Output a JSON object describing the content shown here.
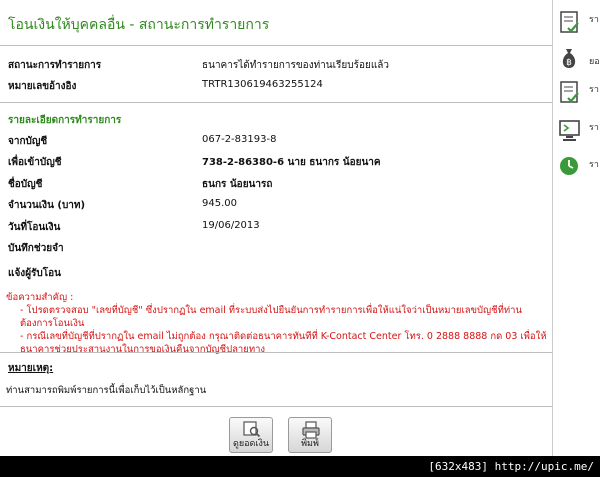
{
  "page": {
    "title": "โอนเงินให้บุคคลอื่น - สถานะการทำรายการ"
  },
  "status": {
    "label": "สถานะการทำรายการ",
    "value": "ธนาคารได้ทำรายการของท่านเรียบร้อยแล้ว"
  },
  "reference": {
    "label": "หมายเลขอ้างอิง",
    "value": "TRTR130619463255124"
  },
  "details": {
    "heading": "รายละเอียดการทำรายการ",
    "from_account_label": "จากบัญชี",
    "from_account_value": "067-2-83193-8",
    "to_account_label": "เพื่อเข้าบัญชี",
    "to_account_value": "738-2-86380-6 นาย ธนากร น้อยนาค",
    "account_name_label": "ชื่อบัญชี",
    "account_name_value": "ธนกร น้อยนารถ",
    "amount_label": "จำนวนเงิน (บาท)",
    "amount_value": "945.00",
    "date_label": "วันที่โอนเงิน",
    "date_value": "19/06/2013",
    "memo_label": "บันทึกช่วยจำ",
    "notify_label": "แจ้งผู้รับโอน"
  },
  "notice": {
    "heading": "ข้อความสำคัญ :",
    "line1": "- โปรดตรวจสอบ \"เลขที่บัญชี\" ซึ่งปรากฏใน email ที่ระบบส่งไปยืนยันการทำรายการเพื่อให้แน่ใจว่าเป็นหมายเลขบัญชีที่ท่านต้องการโอนเงิน",
    "line2": "- กรณีเลขที่บัญชีที่ปรากฏใน email ไม่ถูกต้อง กรุณาติดต่อธนาคารทันทีที่ K-Contact Center โทร. 0 2888 8888 กด 03 เพื่อให้ธนาคารช่วยประสานงานในการขอเงินคืนจากบัญชีปลายทาง"
  },
  "remark": {
    "heading": "หมายเหตุ:",
    "text": "ท่านสามารถพิมพ์รายการนี้เพื่อเก็บไว้เป็นหลักฐาน"
  },
  "buttons": {
    "view_balance": "ดูยอดเงิน",
    "print": "พิมพ์"
  },
  "sidebar": {
    "items": [
      {
        "label": "รา",
        "icon": "document-check-icon"
      },
      {
        "label": "ยอ",
        "icon": "money-bag-icon"
      },
      {
        "label": "รา",
        "icon": "document-check-icon"
      },
      {
        "label": "รา",
        "icon": "monitor-icon"
      },
      {
        "label": "รา",
        "icon": "clock-icon"
      }
    ]
  },
  "watermark": "[632x483] http://upic.me/",
  "colors": {
    "title_green": "#2f8a1e",
    "notice_red": "#d41414",
    "clock_green": "#3a9a3a"
  }
}
